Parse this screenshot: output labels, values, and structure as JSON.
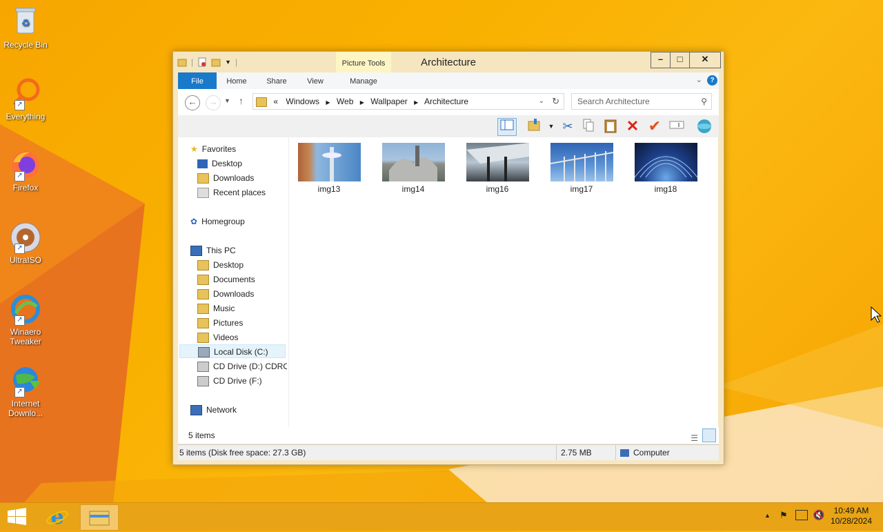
{
  "desktop": {
    "icons": [
      {
        "label": "Recycle Bin"
      },
      {
        "label": "Everything"
      },
      {
        "label": "Firefox"
      },
      {
        "label": "UltraISO"
      },
      {
        "label": "Winaero Tweaker"
      },
      {
        "label": "Internet Downlo..."
      }
    ]
  },
  "window": {
    "title": "Architecture",
    "context_tab": "Picture Tools",
    "controls": {
      "minimize": "–",
      "maximize": "□",
      "close": "✕"
    },
    "ribbon_tabs": [
      "File",
      "Home",
      "Share",
      "View",
      "Manage"
    ],
    "breadcrumb": {
      "prefix": "«",
      "parts": [
        "Windows",
        "Web",
        "Wallpaper",
        "Architecture"
      ]
    },
    "search_placeholder": "Search Architecture",
    "nav": {
      "favorites": {
        "label": "Favorites",
        "items": [
          "Desktop",
          "Downloads",
          "Recent places"
        ]
      },
      "homegroup": {
        "label": "Homegroup"
      },
      "thispc": {
        "label": "This PC",
        "items": [
          "Desktop",
          "Documents",
          "Downloads",
          "Music",
          "Pictures",
          "Videos",
          "Local Disk (C:)",
          "CD Drive (D:) CDROM",
          "CD Drive (F:)"
        ]
      },
      "network": {
        "label": "Network"
      }
    },
    "files": [
      {
        "name": "img13"
      },
      {
        "name": "img14"
      },
      {
        "name": "img16"
      },
      {
        "name": "img17"
      },
      {
        "name": "img18"
      }
    ],
    "item_count": "5 items",
    "status": {
      "left": "5 items (Disk free space: 27.3 GB)",
      "size": "2.75 MB",
      "location": "Computer"
    }
  },
  "taskbar": {
    "time": "10:49 AM",
    "date": "10/28/2024"
  }
}
